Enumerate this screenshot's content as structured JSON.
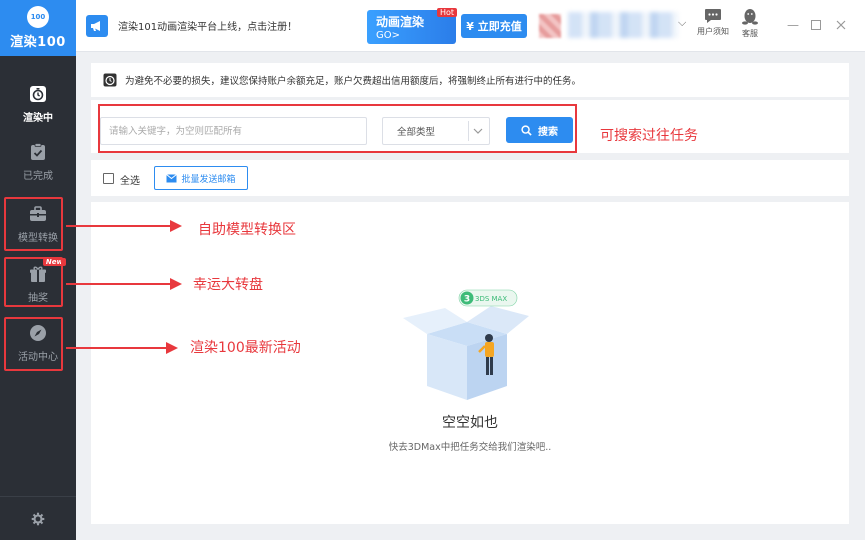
{
  "sidebar": {
    "logo_badge": "100",
    "logo_text": "渲染100",
    "items": [
      {
        "label": "渲染中",
        "active": true
      },
      {
        "label": "已完成"
      },
      {
        "label": "模型转换"
      },
      {
        "label": "抽奖",
        "badge": "New"
      },
      {
        "label": "活动中心"
      }
    ]
  },
  "header": {
    "announcement": "渲染101动画渲染平台上线，点击注册！",
    "promo": {
      "title": "动画渲染",
      "subtitle": "GO>",
      "badge": "Hot"
    },
    "recharge_label": "¥ 立即充值",
    "user_notice_label": "用户须知",
    "service_label": "客服"
  },
  "notice": "为避免不必要的损失，建议您保持账户余额充足，账户欠费超出信用额度后，将强制终止所有进行中的任务。",
  "search": {
    "placeholder": "请输入关键字，为空则匹配所有",
    "type_value": "全部类型",
    "button_label": "搜索"
  },
  "toolbar": {
    "select_all": "全选",
    "bulk_email": "批量发送邮箱"
  },
  "empty": {
    "badge": "3DS MAX",
    "title": "空空如也",
    "subtitle": "快去3DMax中把任务交给我们渲染吧.."
  },
  "annotations": {
    "search": "可搜索过往任务",
    "convert": "自助模型转换区",
    "lottery": "幸运大转盘",
    "activity": "渲染100最新活动"
  },
  "colors": {
    "accent": "#2d8cf0",
    "sidebar": "#2b2f36",
    "annotation": "#e8383d"
  }
}
